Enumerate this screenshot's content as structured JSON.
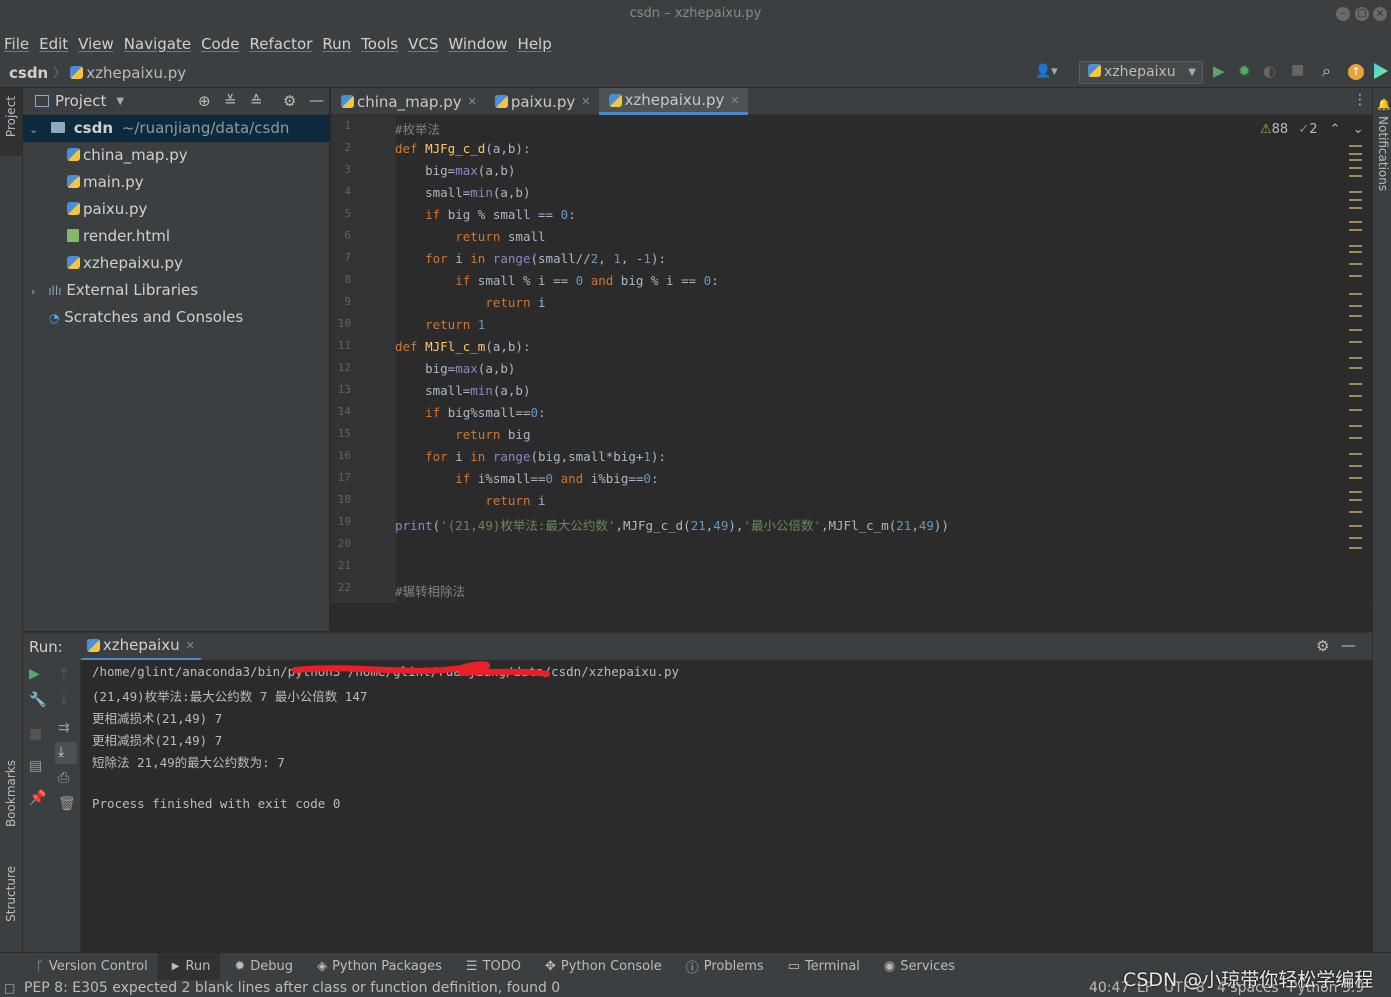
{
  "window": {
    "title": "csdn – xzhepaixu.py"
  },
  "menu": [
    "File",
    "Edit",
    "View",
    "Navigate",
    "Code",
    "Refactor",
    "Run",
    "Tools",
    "VCS",
    "Window",
    "Help"
  ],
  "breadcrumb": {
    "project": "csdn",
    "file": "xzhepaixu.py"
  },
  "run_config": {
    "name": "xzhepaixu"
  },
  "left_strip": {
    "project": "Project",
    "bookmarks": "Bookmarks",
    "structure": "Structure"
  },
  "right_strip": {
    "notifications": "Notifications"
  },
  "project_panel": {
    "title": "Project",
    "root": {
      "name": "csdn",
      "path": "~/ruanjiang/data/csdn"
    },
    "files": [
      "china_map.py",
      "main.py",
      "paixu.py",
      "render.html",
      "xzhepaixu.py"
    ],
    "external": "External Libraries",
    "scratches": "Scratches and Consoles"
  },
  "tabs": [
    {
      "label": "china_map.py"
    },
    {
      "label": "paixu.py"
    },
    {
      "label": "xzhepaixu.py",
      "active": true
    }
  ],
  "inspections": {
    "warnings": "88",
    "weak": "2"
  },
  "editor": {
    "line_numbers": [
      "1",
      "2",
      "3",
      "4",
      "5",
      "6",
      "7",
      "8",
      "9",
      "10",
      "11",
      "12",
      "13",
      "14",
      "15",
      "16",
      "17",
      "18",
      "19",
      "20",
      "21",
      "22"
    ],
    "code": [
      "#枚举法",
      "def MJFg_c_d(a,b):",
      "    big=max(a,b)",
      "    small=min(a,b)",
      "    if big % small == 0:",
      "        return small",
      "    for i in range(small//2, 1, -1):",
      "        if small % i == 0 and big % i == 0:",
      "            return i",
      "    return 1",
      "def MJFl_c_m(a,b):",
      "    big=max(a,b)",
      "    small=min(a,b)",
      "    if big%small==0:",
      "        return big",
      "    for i in range(big,small*big+1):",
      "        if i%small==0 and i%big==0:",
      "            return i",
      "print('(21,49)枚举法:最大公约数',MJFg_c_d(21,49),'最小公倍数',MJFl_c_m(21,49))",
      "",
      "",
      "#辗转相除法"
    ]
  },
  "run_panel": {
    "label": "Run:",
    "tab": "xzhepaixu",
    "output": [
      "/home/glint/anaconda3/bin/python3 /home/glint/ruanjiang/data/csdn/xzhepaixu.py",
      "(21,49)枚举法:最大公约数 7 最小公倍数 147",
      "更相减损术(21,49) 7",
      "更相减损术(21,49) 7",
      "短除法 21,49的最大公约数为: 7",
      "",
      "Process finished with exit code 0"
    ]
  },
  "bottom_tabs": [
    "Version Control",
    "Run",
    "Debug",
    "Python Packages",
    "TODO",
    "Python Console",
    "Problems",
    "Terminal",
    "Services"
  ],
  "status": {
    "message": "PEP 8: E305 expected 2 blank lines after class or function definition, found 0",
    "position": "40:47",
    "line_sep": "LF",
    "encoding": "UTF-8",
    "indent": "4 spaces",
    "interpreter": "Python 3.9"
  },
  "watermark": "CSDN @小琼带你轻松学编程"
}
